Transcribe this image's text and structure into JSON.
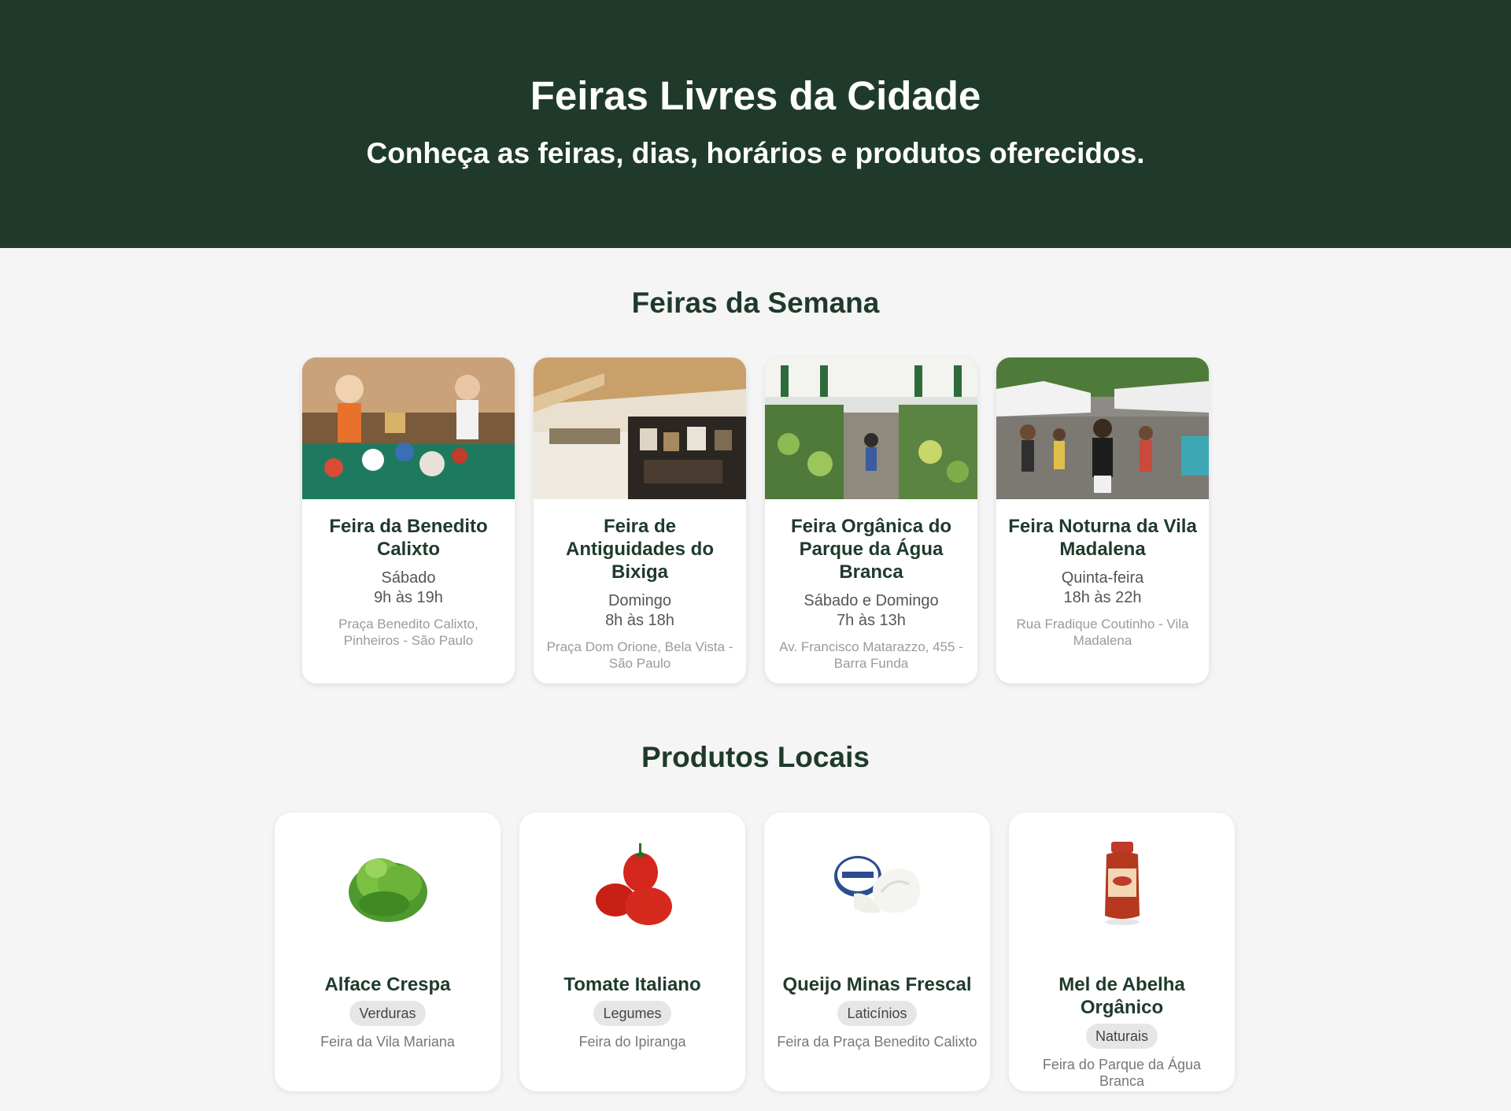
{
  "hero": {
    "title": "Feiras Livres da Cidade",
    "subtitle": "Conheça as feiras, dias, horários e produtos oferecidos."
  },
  "markets": {
    "title": "Feiras da Semana",
    "items": [
      {
        "name": "Feira da Benedito Calixto",
        "day": "Sábado",
        "hours": "9h às 19h",
        "address": "Praça Benedito Calixto, Pinheiros - São Paulo",
        "image": "antiques-table-photo"
      },
      {
        "name": "Feira de Antiguidades do Bixiga",
        "day": "Domingo",
        "hours": "8h às 18h",
        "address": "Praça Dom Orione, Bela Vista - São Paulo",
        "image": "antiques-stall-photo"
      },
      {
        "name": "Feira Orgânica do Parque da Água Branca",
        "day": "Sábado e Domingo",
        "hours": "7h às 13h",
        "address": "Av. Francisco Matarazzo, 455 - Barra Funda",
        "image": "organic-market-photo"
      },
      {
        "name": "Feira Noturna da Vila Madalena",
        "day": "Quinta-feira",
        "hours": "18h às 22h",
        "address": "Rua Fradique Coutinho - Vila Madalena",
        "image": "street-fair-photo"
      }
    ]
  },
  "products": {
    "title": "Produtos Locais",
    "items": [
      {
        "name": "Alface Crespa",
        "category": "Verduras",
        "fair": "Feira da Vila Mariana",
        "image": "lettuce-image"
      },
      {
        "name": "Tomate Italiano",
        "category": "Legumes",
        "fair": "Feira do Ipiranga",
        "image": "tomato-image"
      },
      {
        "name": "Queijo Minas Frescal",
        "category": "Laticínios",
        "fair": "Feira da Praça Benedito Calixto",
        "image": "cheese-image"
      },
      {
        "name": "Mel de Abelha Orgânico",
        "category": "Naturais",
        "fair": "Feira do Parque da Água Branca",
        "image": "honey-image"
      }
    ]
  },
  "colors": {
    "primary": "#1f3a2b",
    "background": "#f5f5f5",
    "card": "#ffffff",
    "tag": "#e6e6e6"
  }
}
